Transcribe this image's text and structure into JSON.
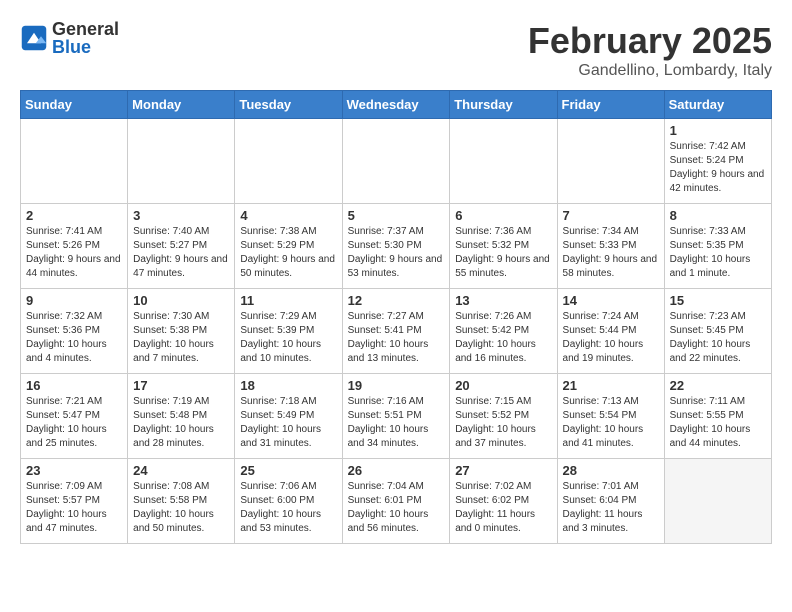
{
  "logo": {
    "general": "General",
    "blue": "Blue"
  },
  "header": {
    "month": "February 2025",
    "location": "Gandellino, Lombardy, Italy"
  },
  "weekdays": [
    "Sunday",
    "Monday",
    "Tuesday",
    "Wednesday",
    "Thursday",
    "Friday",
    "Saturday"
  ],
  "weeks": [
    [
      {
        "day": "",
        "info": ""
      },
      {
        "day": "",
        "info": ""
      },
      {
        "day": "",
        "info": ""
      },
      {
        "day": "",
        "info": ""
      },
      {
        "day": "",
        "info": ""
      },
      {
        "day": "",
        "info": ""
      },
      {
        "day": "1",
        "info": "Sunrise: 7:42 AM\nSunset: 5:24 PM\nDaylight: 9 hours and 42 minutes."
      }
    ],
    [
      {
        "day": "2",
        "info": "Sunrise: 7:41 AM\nSunset: 5:26 PM\nDaylight: 9 hours and 44 minutes."
      },
      {
        "day": "3",
        "info": "Sunrise: 7:40 AM\nSunset: 5:27 PM\nDaylight: 9 hours and 47 minutes."
      },
      {
        "day": "4",
        "info": "Sunrise: 7:38 AM\nSunset: 5:29 PM\nDaylight: 9 hours and 50 minutes."
      },
      {
        "day": "5",
        "info": "Sunrise: 7:37 AM\nSunset: 5:30 PM\nDaylight: 9 hours and 53 minutes."
      },
      {
        "day": "6",
        "info": "Sunrise: 7:36 AM\nSunset: 5:32 PM\nDaylight: 9 hours and 55 minutes."
      },
      {
        "day": "7",
        "info": "Sunrise: 7:34 AM\nSunset: 5:33 PM\nDaylight: 9 hours and 58 minutes."
      },
      {
        "day": "8",
        "info": "Sunrise: 7:33 AM\nSunset: 5:35 PM\nDaylight: 10 hours and 1 minute."
      }
    ],
    [
      {
        "day": "9",
        "info": "Sunrise: 7:32 AM\nSunset: 5:36 PM\nDaylight: 10 hours and 4 minutes."
      },
      {
        "day": "10",
        "info": "Sunrise: 7:30 AM\nSunset: 5:38 PM\nDaylight: 10 hours and 7 minutes."
      },
      {
        "day": "11",
        "info": "Sunrise: 7:29 AM\nSunset: 5:39 PM\nDaylight: 10 hours and 10 minutes."
      },
      {
        "day": "12",
        "info": "Sunrise: 7:27 AM\nSunset: 5:41 PM\nDaylight: 10 hours and 13 minutes."
      },
      {
        "day": "13",
        "info": "Sunrise: 7:26 AM\nSunset: 5:42 PM\nDaylight: 10 hours and 16 minutes."
      },
      {
        "day": "14",
        "info": "Sunrise: 7:24 AM\nSunset: 5:44 PM\nDaylight: 10 hours and 19 minutes."
      },
      {
        "day": "15",
        "info": "Sunrise: 7:23 AM\nSunset: 5:45 PM\nDaylight: 10 hours and 22 minutes."
      }
    ],
    [
      {
        "day": "16",
        "info": "Sunrise: 7:21 AM\nSunset: 5:47 PM\nDaylight: 10 hours and 25 minutes."
      },
      {
        "day": "17",
        "info": "Sunrise: 7:19 AM\nSunset: 5:48 PM\nDaylight: 10 hours and 28 minutes."
      },
      {
        "day": "18",
        "info": "Sunrise: 7:18 AM\nSunset: 5:49 PM\nDaylight: 10 hours and 31 minutes."
      },
      {
        "day": "19",
        "info": "Sunrise: 7:16 AM\nSunset: 5:51 PM\nDaylight: 10 hours and 34 minutes."
      },
      {
        "day": "20",
        "info": "Sunrise: 7:15 AM\nSunset: 5:52 PM\nDaylight: 10 hours and 37 minutes."
      },
      {
        "day": "21",
        "info": "Sunrise: 7:13 AM\nSunset: 5:54 PM\nDaylight: 10 hours and 41 minutes."
      },
      {
        "day": "22",
        "info": "Sunrise: 7:11 AM\nSunset: 5:55 PM\nDaylight: 10 hours and 44 minutes."
      }
    ],
    [
      {
        "day": "23",
        "info": "Sunrise: 7:09 AM\nSunset: 5:57 PM\nDaylight: 10 hours and 47 minutes."
      },
      {
        "day": "24",
        "info": "Sunrise: 7:08 AM\nSunset: 5:58 PM\nDaylight: 10 hours and 50 minutes."
      },
      {
        "day": "25",
        "info": "Sunrise: 7:06 AM\nSunset: 6:00 PM\nDaylight: 10 hours and 53 minutes."
      },
      {
        "day": "26",
        "info": "Sunrise: 7:04 AM\nSunset: 6:01 PM\nDaylight: 10 hours and 56 minutes."
      },
      {
        "day": "27",
        "info": "Sunrise: 7:02 AM\nSunset: 6:02 PM\nDaylight: 11 hours and 0 minutes."
      },
      {
        "day": "28",
        "info": "Sunrise: 7:01 AM\nSunset: 6:04 PM\nDaylight: 11 hours and 3 minutes."
      },
      {
        "day": "",
        "info": ""
      }
    ]
  ]
}
